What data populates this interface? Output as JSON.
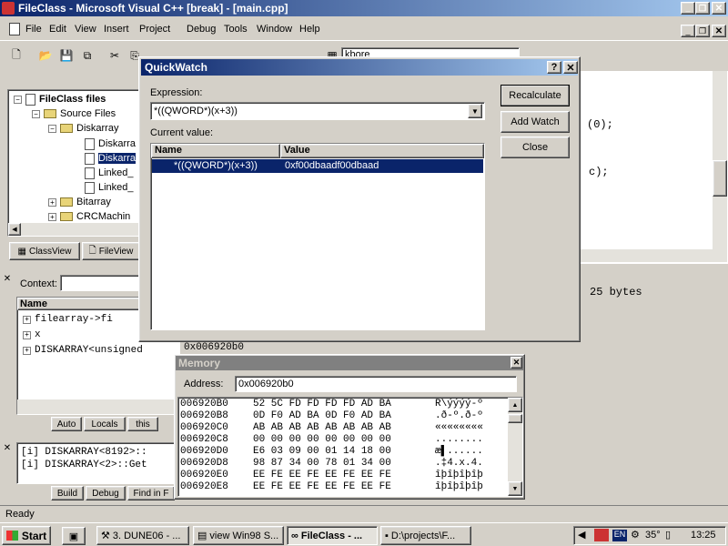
{
  "window": {
    "title": "FileClass - Microsoft Visual C++ [break] - [main.cpp]"
  },
  "menu": [
    "File",
    "Edit",
    "View",
    "Insert",
    "Project",
    "Debug",
    "Tools",
    "Window",
    "Help"
  ],
  "toolbar": {
    "find_combo": "kbore"
  },
  "workspace": {
    "tree": [
      {
        "label": "FileClass files",
        "bold": true
      },
      {
        "label": "Source Files"
      },
      {
        "label": "Diskarray"
      },
      {
        "label": "Diskarra"
      },
      {
        "label": "Diskarra"
      },
      {
        "label": "Linked_"
      },
      {
        "label": "Linked_"
      },
      {
        "label": "Bitarray"
      },
      {
        "label": "CRCMachin"
      }
    ],
    "tabs": [
      "ClassView",
      "FileView"
    ]
  },
  "variables": {
    "context_label": "Context:",
    "header": "Name",
    "rows": [
      "filearray->fi",
      "x",
      "DISKARRAY<unsigned"
    ],
    "row3_value": "0x006920b0",
    "tabs": [
      "Auto",
      "Locals",
      "this"
    ]
  },
  "output": {
    "lines": [
      "[i] DISKARRAY<8192>::",
      "[i] DISKARRAY<2>::Get"
    ],
    "tabs": [
      "Build",
      "Debug",
      "Find in F"
    ]
  },
  "editor": {
    "lines": [
      "(0);",
      "c);"
    ],
    "bytes_text": "25 bytes"
  },
  "quickwatch": {
    "title": "QuickWatch",
    "expression_label": "Expression:",
    "expression_value": "*((QWORD*)(x+3))",
    "current_value_label": "Current value:",
    "col_name": "Name",
    "col_value": "Value",
    "row_name": "*((QWORD*)(x+3))",
    "row_value": "0xf00dbaadf00dbaad",
    "buttons": [
      "Recalculate",
      "Add Watch",
      "Close"
    ]
  },
  "memory": {
    "title": "Memory",
    "address_label": "Address:",
    "address_value": "0x006920b0",
    "rows": [
      {
        "addr": "006920B0",
        "hex": "52 5C FD FD FD FD AD BA",
        "ascii": "R\\ýýýý-º"
      },
      {
        "addr": "006920B8",
        "hex": "0D F0 AD BA 0D F0 AD BA",
        "ascii": ".ð-º.ð-º"
      },
      {
        "addr": "006920C0",
        "hex": "AB AB AB AB AB AB AB AB",
        "ascii": "««««««««"
      },
      {
        "addr": "006920C8",
        "hex": "00 00 00 00 00 00 00 00",
        "ascii": "........"
      },
      {
        "addr": "006920D0",
        "hex": "E6 03 09 00 01 14 18 00",
        "ascii": "æ▌......"
      },
      {
        "addr": "006920D8",
        "hex": "98 87 34 00 78 01 34 00",
        "ascii": ".‡4.x.4."
      },
      {
        "addr": "006920E0",
        "hex": "EE FE EE FE EE FE EE FE",
        "ascii": "îþîþîþîþ"
      },
      {
        "addr": "006920E8",
        "hex": "EE FE EE FE EE FE EE FE",
        "ascii": "îþîþîþîþ"
      }
    ]
  },
  "statusbar": {
    "text": "Ready"
  },
  "taskbar": {
    "start": "Start",
    "tasks": [
      "3. DUNE06 - ...",
      "view Win98 S...",
      "FileClass - ...",
      "D:\\projects\\F..."
    ],
    "temp": "35°",
    "lang": "EN",
    "clock": "13:25"
  }
}
